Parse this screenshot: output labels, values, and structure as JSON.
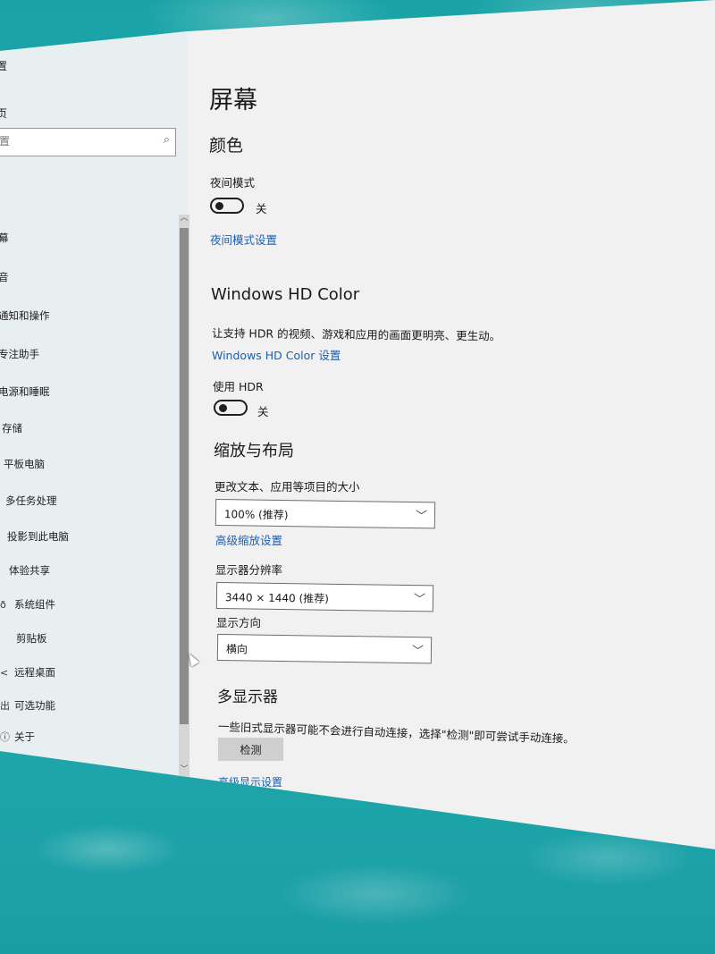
{
  "sidebar": {
    "app_title": "置",
    "subtitle": "页",
    "search_placeholder": "置",
    "items": [
      {
        "label": "幕",
        "icon": ""
      },
      {
        "label": "音",
        "icon": ""
      },
      {
        "label": "通知和操作",
        "icon": ""
      },
      {
        "label": "专注助手",
        "icon": ""
      },
      {
        "label": "电源和睡眠",
        "icon": ""
      },
      {
        "label": "存储",
        "icon": ""
      },
      {
        "label": "平板电脑",
        "icon": ""
      },
      {
        "label": "多任务处理",
        "icon": ""
      },
      {
        "label": "投影到此电脑",
        "icon": ""
      },
      {
        "label": "体验共享",
        "icon": ""
      },
      {
        "label": "系统组件",
        "icon": "ð"
      },
      {
        "label": "剪贴板",
        "icon": ""
      },
      {
        "label": "远程桌面",
        "icon": "<"
      },
      {
        "label": "可选功能",
        "icon": "出"
      },
      {
        "label": "关于",
        "icon": "ⓘ"
      }
    ]
  },
  "main": {
    "page_title": "屏幕",
    "color_heading": "颜色",
    "night_mode_label": "夜间模式",
    "night_mode_state": "关",
    "night_mode_on": false,
    "night_mode_link": "夜间模式设置",
    "hdr_heading": "Windows HD Color",
    "hdr_desc": "让支持 HDR 的视频、游戏和应用的画面更明亮、更生动。",
    "hdr_link": "Windows HD Color 设置",
    "use_hdr_label": "使用 HDR",
    "use_hdr_state": "关",
    "use_hdr_on": false,
    "scale_heading": "缩放与布局",
    "scale_label": "更改文本、应用等项目的大小",
    "scale_value": "100% (推荐)",
    "advanced_scale_link": "高级缩放设置",
    "resolution_label": "显示器分辨率",
    "resolution_value": "3440 × 1440 (推荐)",
    "orientation_label": "显示方向",
    "orientation_value": "横向",
    "multi_heading": "多显示器",
    "multi_desc": "一些旧式显示器可能不会进行自动连接，选择\"检测\"即可尝试手动连接。",
    "detect_button": "检测",
    "advanced_display_link": "高级显示设置"
  },
  "colors": {
    "link": "#1a5fb4",
    "background": "#f1f1f1",
    "sidebar": "#e7eff0"
  }
}
